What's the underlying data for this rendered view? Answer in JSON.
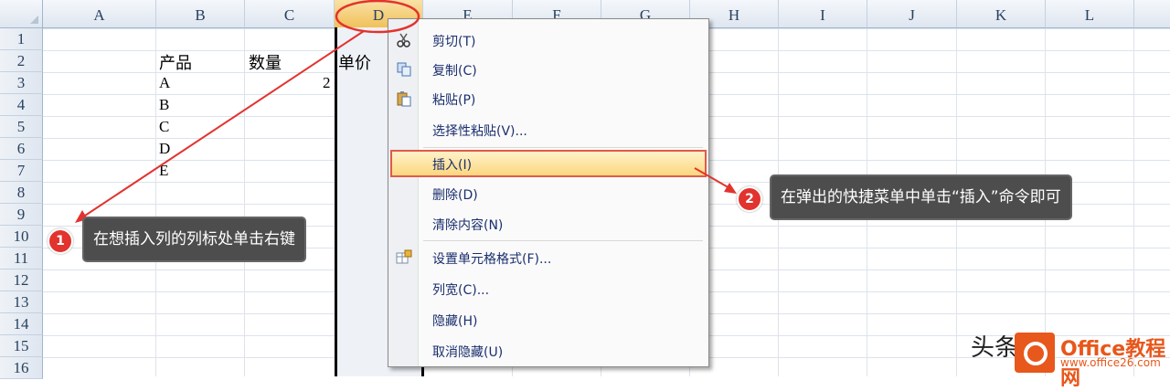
{
  "columns": [
    "A",
    "B",
    "C",
    "D",
    "E",
    "F",
    "G",
    "H",
    "I",
    "J",
    "K",
    "L"
  ],
  "rows": [
    "1",
    "2",
    "3",
    "4",
    "5",
    "6",
    "7",
    "8",
    "9",
    "10",
    "11",
    "12",
    "13",
    "14",
    "15",
    "16"
  ],
  "cells": {
    "b2": "产品",
    "c2": "数量",
    "d2": "单价",
    "c3": "2",
    "b3": "A",
    "b4": "B",
    "b5": "C",
    "b6": "D",
    "b7": "E"
  },
  "menu": {
    "cut": "剪切(T)",
    "copy": "复制(C)",
    "paste": "粘贴(P)",
    "paste_special": "选择性粘贴(V)...",
    "insert": "插入(I)",
    "delete": "删除(D)",
    "clear": "清除内容(N)",
    "format_cells": "设置单元格格式(F)...",
    "col_width": "列宽(C)...",
    "hide": "隐藏(H)",
    "unhide": "取消隐藏(U)"
  },
  "callouts": {
    "one_num": "1",
    "one_text": "在想插入列的列标处单击右键",
    "two_num": "2",
    "two_text": "在弹出的快捷菜单中单击“插入”命令即可"
  },
  "watermark": {
    "text": "头条",
    "site": "Office教程网",
    "url": "www.office26.com"
  },
  "colors": {
    "accent": "#e2332e",
    "highlight": "#fbd77f",
    "menu_text": "#1a2f6e"
  }
}
